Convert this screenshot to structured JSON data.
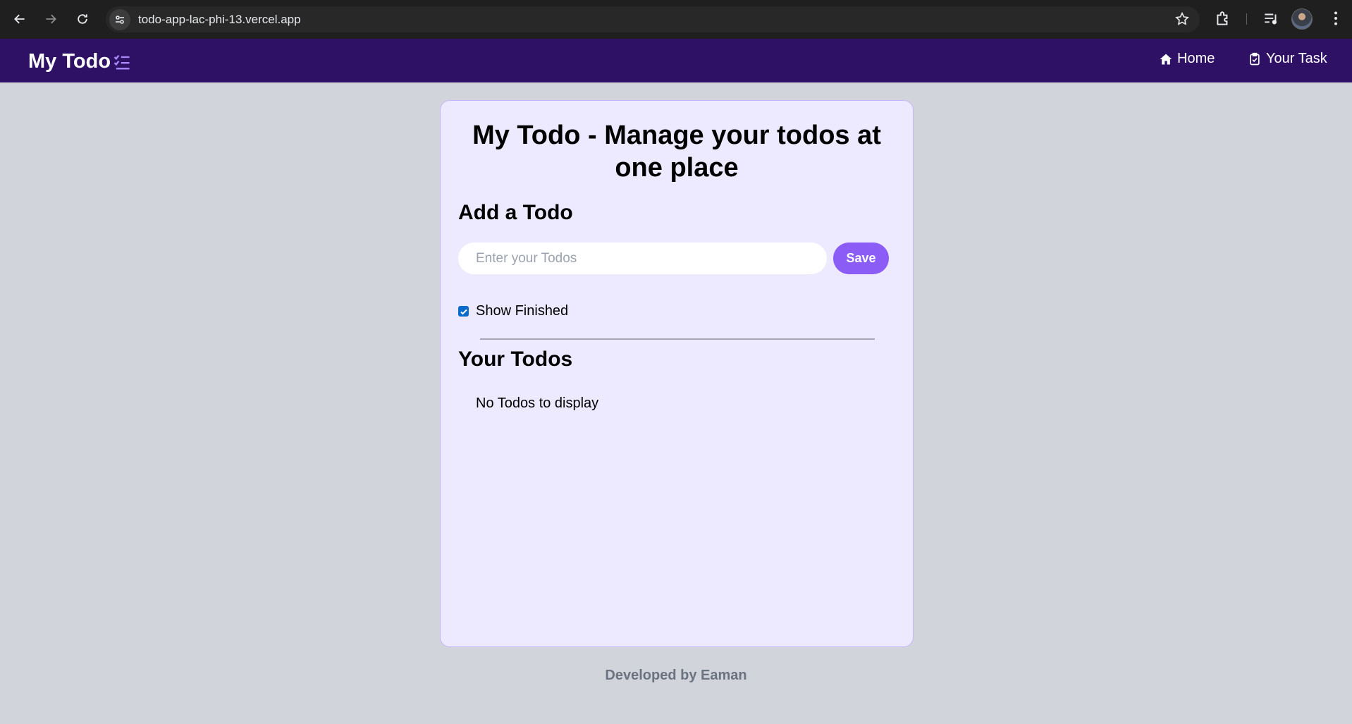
{
  "browser": {
    "url": "todo-app-lac-phi-13.vercel.app"
  },
  "navbar": {
    "brand": "My Todo",
    "links": [
      {
        "label": "Home",
        "icon": "home-icon"
      },
      {
        "label": "Your Task",
        "icon": "task-check-icon"
      }
    ],
    "colors": {
      "background": "#2e1065",
      "accent": "#a78bfa"
    }
  },
  "card": {
    "title": "My Todo - Manage your todos at one place",
    "add_heading": "Add a Todo",
    "input": {
      "placeholder": "Enter your Todos",
      "value": ""
    },
    "save_label": "Save",
    "show_finished": {
      "label": "Show Finished",
      "checked": true
    },
    "your_todos_heading": "Your Todos",
    "empty_message": "No Todos to display",
    "colors": {
      "background": "#ede9fe",
      "button": "#8b5cf6"
    }
  },
  "footer": {
    "text": "Developed by Eaman"
  }
}
